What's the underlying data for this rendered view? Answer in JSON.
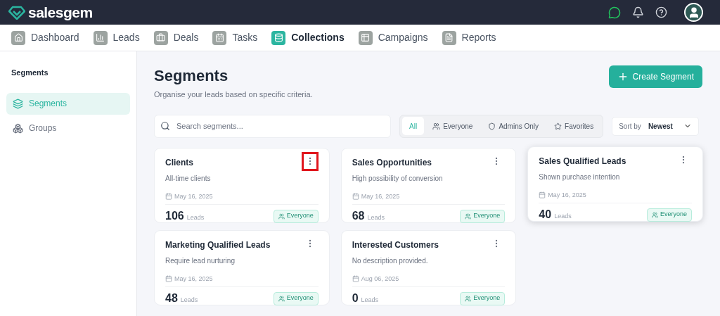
{
  "brand": {
    "name": "salesgem"
  },
  "nav": [
    {
      "label": "Dashboard",
      "selected": false
    },
    {
      "label": "Leads",
      "selected": false
    },
    {
      "label": "Deals",
      "selected": false
    },
    {
      "label": "Tasks",
      "selected": false
    },
    {
      "label": "Collections",
      "selected": true
    },
    {
      "label": "Campaigns",
      "selected": false
    },
    {
      "label": "Reports",
      "selected": false
    }
  ],
  "sidebar": {
    "title": "Segments",
    "items": [
      {
        "label": "Segments",
        "selected": true
      },
      {
        "label": "Groups",
        "selected": false
      }
    ]
  },
  "page": {
    "title": "Segments",
    "subtitle": "Organise your leads based on specific criteria.",
    "create_button": "Create Segment"
  },
  "search": {
    "placeholder": "Search segments..."
  },
  "filters": [
    {
      "label": "All",
      "selected": true
    },
    {
      "label": "Everyone",
      "selected": false
    },
    {
      "label": "Admins Only",
      "selected": false
    },
    {
      "label": "Favorites",
      "selected": false
    }
  ],
  "sort": {
    "label": "Sort by",
    "value": "Newest"
  },
  "segments": [
    {
      "name": "Clients",
      "description": "All-time clients",
      "date": "May 16, 2025",
      "count": "106",
      "unit": "Leads",
      "audience": "Everyone",
      "menu_highlighted": true,
      "hovered": false
    },
    {
      "name": "Sales Opportunities",
      "description": "High possibility of conversion",
      "date": "May 16, 2025",
      "count": "68",
      "unit": "Leads",
      "audience": "Everyone",
      "menu_highlighted": false,
      "hovered": false
    },
    {
      "name": "Sales Qualified Leads",
      "description": "Shown purchase intention",
      "date": "May 16, 2025",
      "count": "40",
      "unit": "Leads",
      "audience": "Everyone",
      "menu_highlighted": false,
      "hovered": true
    },
    {
      "name": "Marketing Qualified Leads",
      "description": "Require lead nurturing",
      "date": "May 16, 2025",
      "count": "48",
      "unit": "Leads",
      "audience": "Everyone",
      "menu_highlighted": false,
      "hovered": false
    },
    {
      "name": "Interested Customers",
      "description": "No description provided.",
      "date": "Aug 06, 2025",
      "count": "0",
      "unit": "Leads",
      "audience": "Everyone",
      "menu_highlighted": false,
      "hovered": false
    }
  ]
}
